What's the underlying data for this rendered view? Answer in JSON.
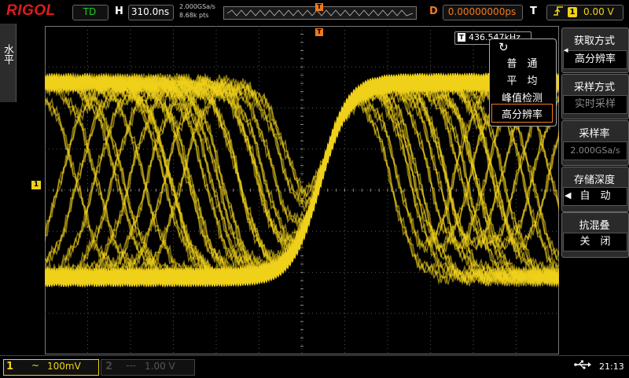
{
  "topbar": {
    "logo": "RIGOL",
    "run_status": "TD",
    "h_label": "H",
    "timebase": "310.0ns",
    "sample_rate": "2.000GSa/s",
    "mem_points": "8.68k pts",
    "trigger_marker": "T",
    "d_label": "D",
    "delay": "0.00000000ps",
    "t_label": "T",
    "trigger_source": "1",
    "trigger_level": "0.00 V"
  },
  "left_tab": {
    "label": "水平"
  },
  "scope": {
    "ch1_marker": "1",
    "trigger_position_marker": "T",
    "freq_label": "T",
    "frequency": "436.547kHz"
  },
  "acquire_popup": {
    "items": [
      {
        "label": "普　通"
      },
      {
        "label": "平　均"
      },
      {
        "label": "峰值检测"
      },
      {
        "label": "高分辨率"
      }
    ],
    "selected_index": 3
  },
  "right_menu": {
    "acquire_mode_title": "获取方式",
    "acquire_mode_value": "高分辨率",
    "sample_mode_title": "采样方式",
    "sample_mode_value": "实时采样",
    "sample_rate_title": "采样率",
    "sample_rate_value": "2.000GSa/s",
    "mem_depth_title": "存储深度",
    "mem_depth_value": "自　动",
    "antialias_title": "抗混叠",
    "antialias_value": "关　闭"
  },
  "bottombar": {
    "ch1_number": "1",
    "ch1_coupling": "~",
    "ch1_scale": "100mV",
    "ch2_number": "2",
    "ch2_coupling": "---",
    "ch2_scale": "1.00 V",
    "usb_icon": "usb-icon",
    "time": "21:13"
  },
  "colors": {
    "ch1": "#f0d21c",
    "trigger": "#f07a1c",
    "logo": "#e01a1a",
    "run_status": "#19d020"
  }
}
